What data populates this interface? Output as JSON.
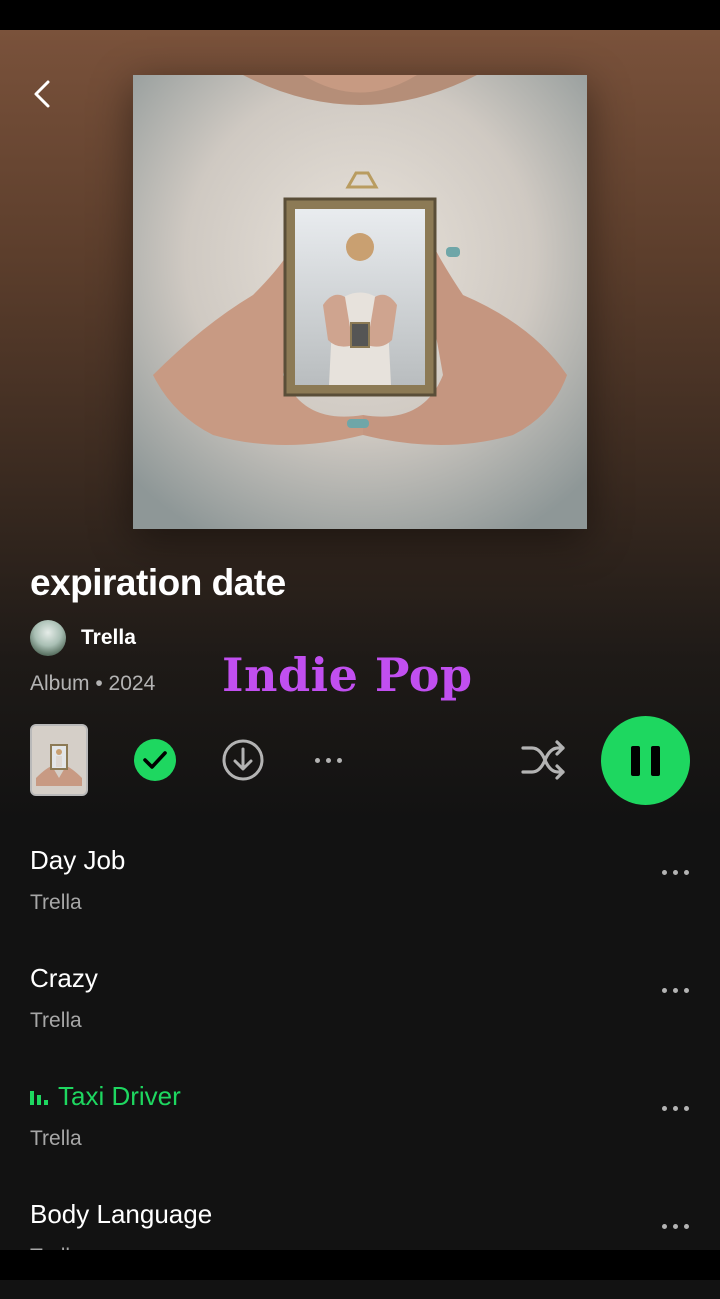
{
  "album": {
    "title": "expiration date",
    "artist": "Trella",
    "meta": "Album • 2024"
  },
  "overlay": {
    "genre_text": "Indie Pop"
  },
  "controls": {
    "saved": true,
    "accent_color": "#1ed760",
    "playing": true,
    "icons": [
      "chevron-left-icon",
      "saved-check-icon",
      "download-icon",
      "more-icon",
      "shuffle-icon",
      "pause-icon"
    ]
  },
  "tracks": [
    {
      "title": "Day Job",
      "artist": "Trella",
      "playing": false
    },
    {
      "title": "Crazy",
      "artist": "Trella",
      "playing": false
    },
    {
      "title": "Taxi Driver",
      "artist": "Trella",
      "playing": true
    },
    {
      "title": "Body Language",
      "artist": "Trella",
      "playing": false
    }
  ]
}
